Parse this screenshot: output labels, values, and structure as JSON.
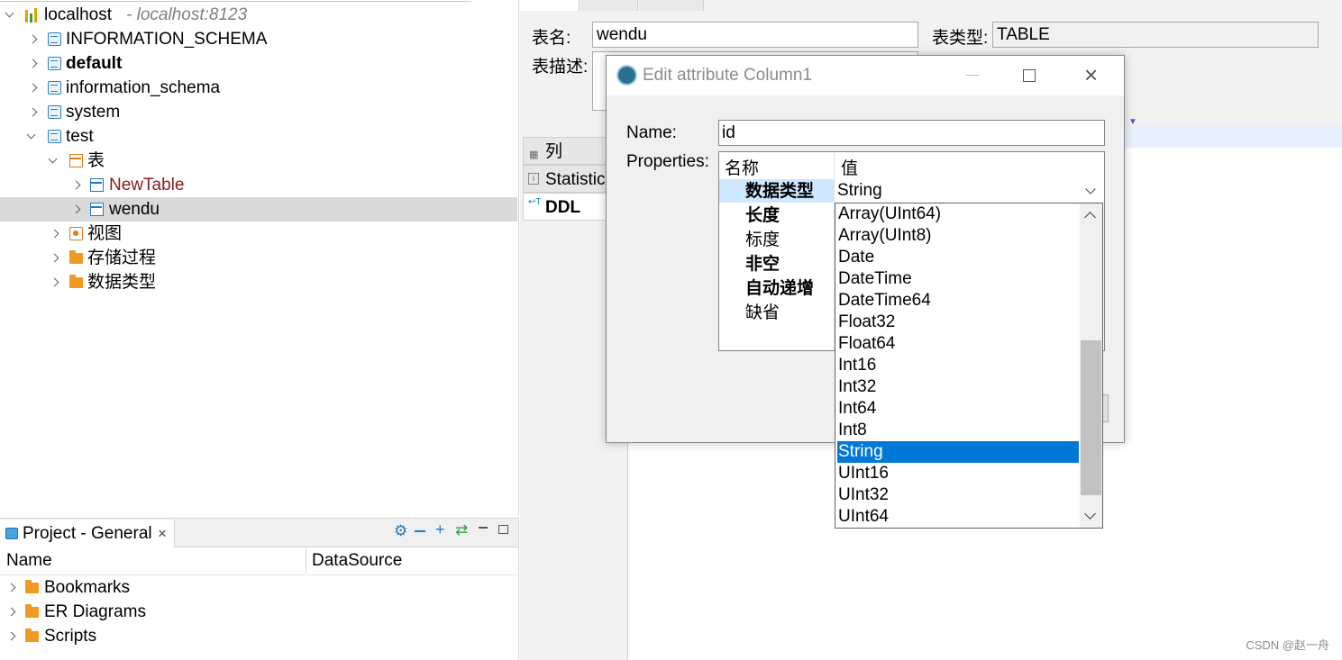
{
  "nav_tree": {
    "connection": {
      "name": "localhost",
      "detail": " - localhost:8123"
    },
    "databases": [
      "INFORMATION_SCHEMA",
      "default",
      "information_schema",
      "system",
      "test"
    ],
    "tables_folder": "表",
    "tables": [
      "NewTable",
      "wendu"
    ],
    "views_folder": "视图",
    "procedures_folder": "存储过程",
    "datatypes_folder": "数据类型"
  },
  "project_panel": {
    "tab_title": "Project - General",
    "columns": [
      "Name",
      "DataSource"
    ],
    "items": [
      "Bookmarks",
      "ER Diagrams",
      "Scripts"
    ]
  },
  "editor": {
    "table_name_label": "表名:",
    "table_name_value": "wendu",
    "table_type_label": "表类型:",
    "table_type_value": "TABLE",
    "description_label": "表描述:",
    "side_tabs": [
      "列",
      "Statistic",
      "DDL"
    ]
  },
  "dialog": {
    "title": "Edit attribute Column1",
    "name_label": "Name:",
    "name_value": "id",
    "properties_label": "Properties:",
    "props_header": [
      "名称",
      "值"
    ],
    "props": [
      {
        "name": "数据类型",
        "value": "String"
      },
      {
        "name": "长度",
        "value": ""
      },
      {
        "name": "标度",
        "value": ""
      },
      {
        "name": "非空",
        "value": ""
      },
      {
        "name": "自动递增",
        "value": ""
      },
      {
        "name": "缺省",
        "value": ""
      }
    ]
  },
  "type_dropdown": {
    "selected": "String",
    "options": [
      "Array(UInt64)",
      "Array(UInt8)",
      "Date",
      "DateTime",
      "DateTime64",
      "Float32",
      "Float64",
      "Int16",
      "Int32",
      "Int64",
      "Int8",
      "String",
      "UInt16",
      "UInt32",
      "UInt64"
    ]
  },
  "watermark": "CSDN @赵一舟",
  "colors": {
    "accent": "#0078d7",
    "folder": "#f09a25",
    "table_icon": "#1f78c1"
  }
}
